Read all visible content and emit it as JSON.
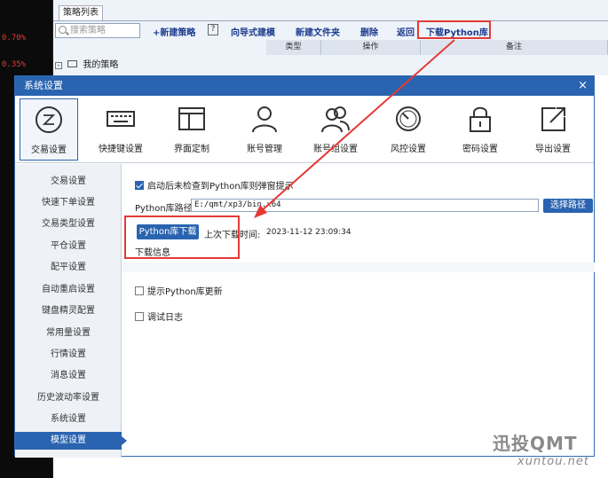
{
  "background": {
    "left_values": [
      "0.70%",
      "0.35%"
    ],
    "tab_label": "策略列表",
    "search_placeholder": "搜索策略",
    "toolbar": {
      "new_strategy": "+新建策略",
      "help": "?",
      "wizard": "向导式建模",
      "new_folder": "新建文件夹",
      "delete": "删除",
      "back": "返回",
      "download_python_lib": "下载Python库"
    },
    "table_headers": [
      "类型",
      "操作",
      "备注"
    ],
    "tree_root": "我的策略"
  },
  "dialog": {
    "title": "系统设置",
    "close": "×",
    "tabs": [
      {
        "label": "交易设置",
        "icon": "trade-settings-icon",
        "active": true
      },
      {
        "label": "快捷键设置",
        "icon": "keyboard-icon",
        "active": false
      },
      {
        "label": "界面定制",
        "icon": "layout-icon",
        "active": false
      },
      {
        "label": "账号管理",
        "icon": "user-icon",
        "active": false
      },
      {
        "label": "账号组设置",
        "icon": "user-group-icon",
        "active": false
      },
      {
        "label": "风控设置",
        "icon": "gauge-icon",
        "active": false
      },
      {
        "label": "密码设置",
        "icon": "lock-icon",
        "active": false
      },
      {
        "label": "导出设置",
        "icon": "export-icon",
        "active": false
      }
    ],
    "sidebar": [
      {
        "label": "交易设置",
        "active": false
      },
      {
        "label": "快速下单设置",
        "active": false
      },
      {
        "label": "交易类型设置",
        "active": false
      },
      {
        "label": "平仓设置",
        "active": false
      },
      {
        "label": "配平设置",
        "active": false
      },
      {
        "label": "自动重启设置",
        "active": false
      },
      {
        "label": "键盘精灵配置",
        "active": false
      },
      {
        "label": "常用量设置",
        "active": false
      },
      {
        "label": "行情设置",
        "active": false
      },
      {
        "label": "消息设置",
        "active": false
      },
      {
        "label": "历史波动率设置",
        "active": false
      },
      {
        "label": "系统设置",
        "active": false
      },
      {
        "label": "模型设置",
        "active": true
      }
    ],
    "model_settings": {
      "auto_check_label": "启动后未检查到Python库则弹窗提示",
      "auto_check_checked": true,
      "path_label": "Python库路径",
      "path_value": "E:/qmt/xp3/bin.x64",
      "choose_path_button": "选择路径",
      "download_button": "Python库下载",
      "last_download_label": "上次下载时间:",
      "last_download_time": "2023-11-12  23:09:34",
      "download_info_label": "下载信息",
      "update_prompt_label": "提示Python库更新",
      "update_prompt_checked": false,
      "debug_log_label": "调试日志",
      "debug_log_checked": false
    }
  },
  "watermark": {
    "cn": "迅投QMT",
    "en": "xuntou.net"
  },
  "colors": {
    "accent": "#2a64b0",
    "highlight": "#e53935"
  }
}
